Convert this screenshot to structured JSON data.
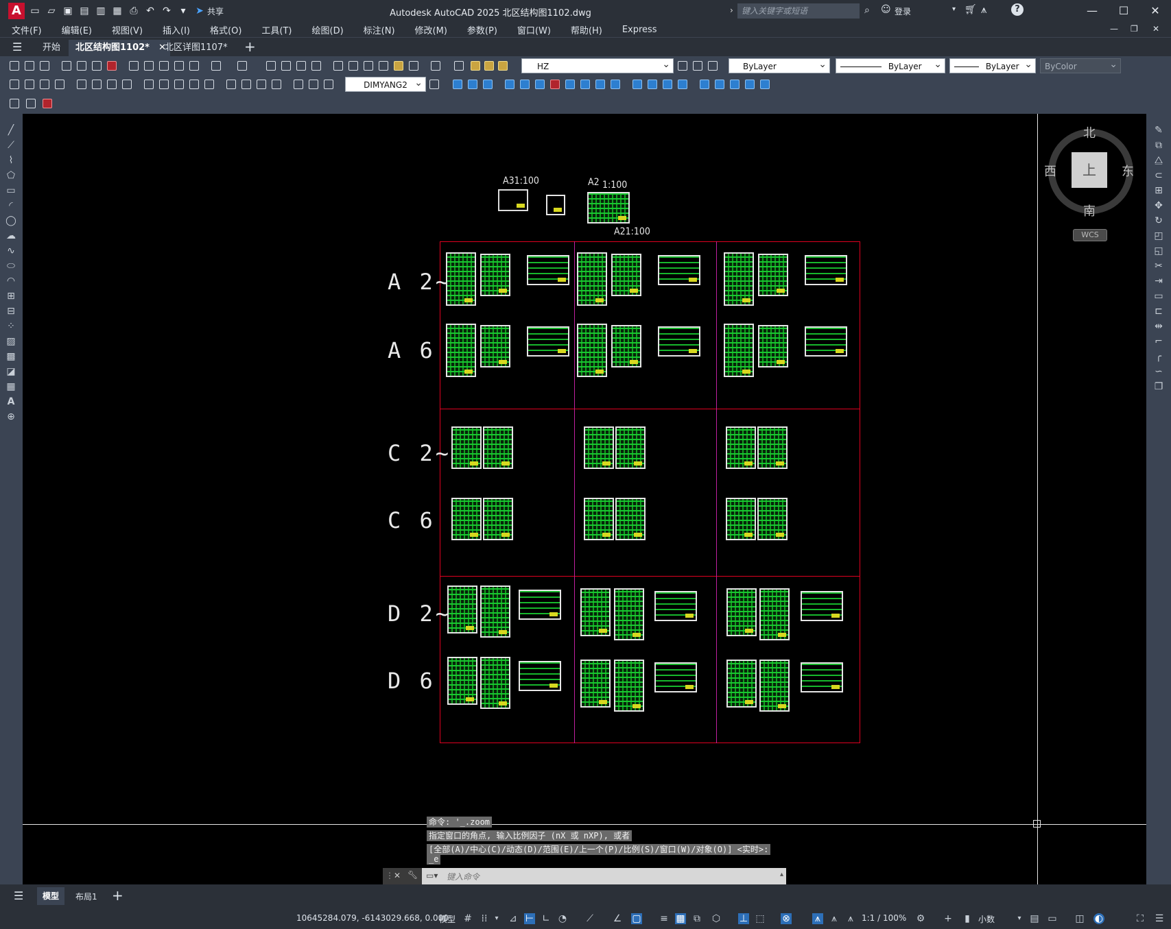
{
  "app": {
    "title": "Autodesk AutoCAD 2025    北区结构图1102.dwg",
    "share_label": "共享",
    "search_placeholder": "键入关键字或短语",
    "login_label": "登录"
  },
  "menu": [
    "文件(F)",
    "编辑(E)",
    "视图(V)",
    "插入(I)",
    "格式(O)",
    "工具(T)",
    "绘图(D)",
    "标注(N)",
    "修改(M)",
    "参数(P)",
    "窗口(W)",
    "帮助(H)",
    "Express"
  ],
  "tabs": [
    {
      "label": "开始"
    },
    {
      "label": "北区结构图1102*",
      "active": true
    },
    {
      "label": "北区详图1107*"
    }
  ],
  "toolbar": {
    "layer_value": "HZ",
    "color_value": "ByLayer",
    "linetype_value": "ByLayer",
    "lineweight_value": "ByLayer",
    "plotstyle_value": "ByColor",
    "dimstyle_value": "DIMYANG2"
  },
  "drawing": {
    "header_labels": [
      "A31:100",
      "A2",
      "1:100",
      "A21:100"
    ],
    "row_labels": [
      "A 2~5",
      "A 6",
      "C 2~5",
      "C 6",
      "D 2~5",
      "D 6"
    ]
  },
  "compass": {
    "north": "北",
    "south": "南",
    "east": "东",
    "west": "西",
    "face": "上",
    "wcs": "WCS"
  },
  "command": {
    "history": [
      "命令: '_.zoom",
      "指定窗口的角点, 输入比例因子 (nX 或 nXP), 或者",
      "[全部(A)/中心(C)/动态(D)/范围(E)/上一个(P)/比例(S)/窗口(W)/对象(O)] <实时>:",
      "_e"
    ],
    "input_placeholder": "键入命令"
  },
  "layout_tabs": [
    "模型",
    "布局1"
  ],
  "status": {
    "coordinates": "10645284.079, -6143029.668, 0.000",
    "space": "模型",
    "scale": "1:1 / 100%",
    "units": "小数"
  },
  "colors": {
    "accent": "#c8102e",
    "canvas": "#000000",
    "frame_red": "#e00020",
    "frame_magenta": "#c020a0",
    "drawing_green": "#18c830"
  }
}
